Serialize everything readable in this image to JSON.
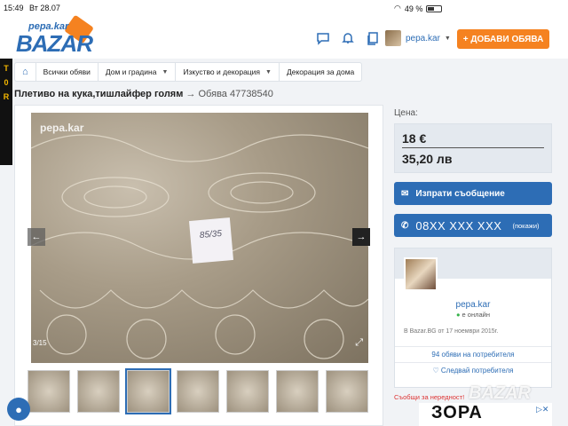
{
  "status_bar": {
    "time": "15:49",
    "date": "Вт 28.07",
    "battery": "49 %"
  },
  "header": {
    "logo_small": "pepa.kar",
    "logo_big": "BAZAR",
    "username": "pepa.kar",
    "add_button": "+ ДОБАВИ ОБЯВА"
  },
  "breadcrumbs": [
    "Всички обяви",
    "Дом и градина",
    "Изкуство и декорация",
    "Декорация за дома"
  ],
  "listing": {
    "title": "Плетиво на кука,тишлайфер голям",
    "arrow": "→",
    "ad_number": "Обява 47738540",
    "photo_watermark": "pepa.kar",
    "photo_note": "85/35",
    "photo_counter": "3/15",
    "thumbnail_count": 7,
    "active_thumbnail": 3
  },
  "pricing": {
    "label": "Цена:",
    "eur": "18 €",
    "bgn": "35,20 лв"
  },
  "contact": {
    "message_button": "Изпрати съобщение",
    "phone": "08XX XXX XXX",
    "show_phone": "(покажи)"
  },
  "seller": {
    "name": "pepa.kar",
    "status": "е онлайн",
    "since": "В Bazar.BG от 17 ноември 2015г.",
    "ads_link": "94 обяви на потребителя",
    "follow": "Следвай потребителя"
  },
  "report": "Съобщи за нередност!",
  "ad_banner": {
    "text": "ЗОРА",
    "watermark": "BAZAR"
  },
  "colors": {
    "primary": "#2d6db5",
    "accent": "#f58220",
    "danger": "#dd3333"
  }
}
